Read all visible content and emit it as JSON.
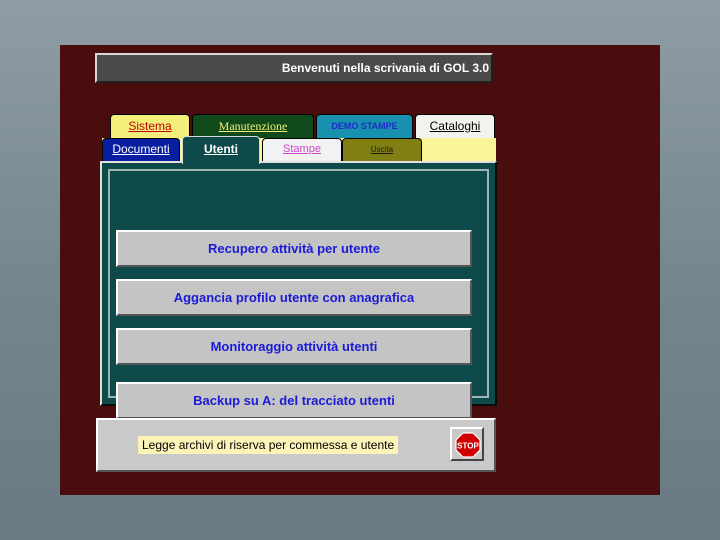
{
  "title": "Benvenuti nella scrivania di GOL 3.0",
  "tabs_row1": [
    {
      "label": "Sistema",
      "color": "#f2ef7a"
    },
    {
      "label": "Manutenzione",
      "color": "#114a1a"
    },
    {
      "label": "DEMO STAMPE",
      "color": "#1791ad"
    },
    {
      "label": "Cataloghi",
      "color": "#f3f3ee"
    }
  ],
  "tabs_row2": [
    {
      "label": "Documenti",
      "color": "#0a1fa0"
    },
    {
      "label": "Utenti",
      "color": "#0f4a4a",
      "active": true
    },
    {
      "label": "Stampe",
      "color": "#f2f2f2"
    },
    {
      "label": "Uscita",
      "color": "#7f7f14"
    }
  ],
  "buttons": [
    "Recupero attività per utente",
    "Aggancia profilo utente con anagrafica",
    "Monitoraggio attività utenti",
    "Backup su A:  del tracciato utenti"
  ],
  "status": {
    "text": "Legge archivi di riserva per commessa e utente",
    "stop_label": "STOP",
    "stop_icon": "stop-sign-icon"
  },
  "colors": {
    "window_bg": "#4a0d0d",
    "panel_bg": "#0f4a4a",
    "button_text": "#1a1ad8"
  }
}
